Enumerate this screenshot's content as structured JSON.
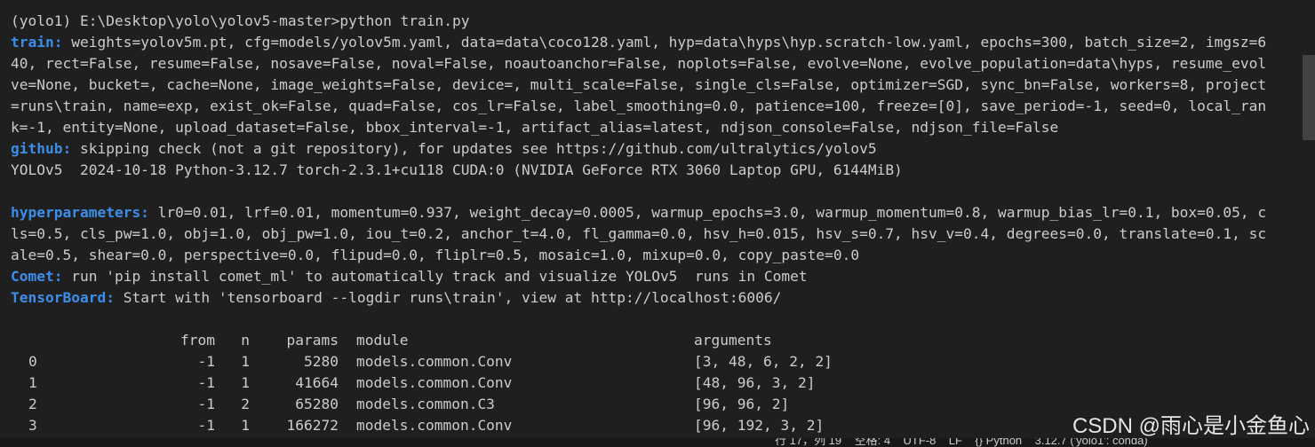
{
  "terminal": {
    "prompt_line": "(yolo1) E:\\Desktop\\yolo\\yolov5-master>python train.py",
    "train": {
      "tag": "train:",
      "lines": [
        " weights=yolov5m.pt, cfg=models/yolov5m.yaml, data=data\\coco128.yaml, hyp=data\\hyps\\hyp.scratch-low.yaml, epochs=300, batch_size=2, imgsz=6",
        "40, rect=False, resume=False, nosave=False, noval=False, noautoanchor=False, noplots=False, evolve=None, evolve_population=data\\hyps, resume_evol",
        "ve=None, bucket=, cache=None, image_weights=False, device=, multi_scale=False, single_cls=False, optimizer=SGD, sync_bn=False, workers=8, project",
        "=runs\\train, name=exp, exist_ok=False, quad=False, cos_lr=False, label_smoothing=0.0, patience=100, freeze=[0], save_period=-1, seed=0, local_ran",
        "k=-1, entity=None, upload_dataset=False, bbox_interval=-1, artifact_alias=latest, ndjson_console=False, ndjson_file=False"
      ]
    },
    "github": {
      "tag": "github:",
      "text": " skipping check (not a git repository), for updates see https://github.com/ultralytics/yolov5"
    },
    "yolo_info": "YOLOv5  2024-10-18 Python-3.12.7 torch-2.3.1+cu118 CUDA:0 (NVIDIA GeForce RTX 3060 Laptop GPU, 6144MiB)",
    "hyperparameters": {
      "tag": "hyperparameters:",
      "lines": [
        " lr0=0.01, lrf=0.01, momentum=0.937, weight_decay=0.0005, warmup_epochs=3.0, warmup_momentum=0.8, warmup_bias_lr=0.1, box=0.05, c",
        "ls=0.5, cls_pw=1.0, obj=1.0, obj_pw=1.0, iou_t=0.2, anchor_t=4.0, fl_gamma=0.0, hsv_h=0.015, hsv_s=0.7, hsv_v=0.4, degrees=0.0, translate=0.1, sc",
        "ale=0.5, shear=0.0, perspective=0.0, flipud=0.0, fliplr=0.5, mosaic=1.0, mixup=0.0, copy_paste=0.0"
      ]
    },
    "comet": {
      "tag": "Comet:",
      "text": " run 'pip install comet_ml' to automatically track and visualize YOLOv5  runs in Comet"
    },
    "tensorboard": {
      "tag": "TensorBoard:",
      "text": " Start with 'tensorboard --logdir runs\\train', view at http://localhost:6006/"
    },
    "model_table": {
      "headers": {
        "from": "from",
        "n": "n",
        "params": "params",
        "module": "module",
        "arguments": "arguments"
      },
      "rows": [
        {
          "idx": "0",
          "from": "-1",
          "n": "1",
          "params": "5280",
          "module": "models.common.Conv",
          "arguments": "[3, 48, 6, 2, 2]"
        },
        {
          "idx": "1",
          "from": "-1",
          "n": "1",
          "params": "41664",
          "module": "models.common.Conv",
          "arguments": "[48, 96, 3, 2]"
        },
        {
          "idx": "2",
          "from": "-1",
          "n": "2",
          "params": "65280",
          "module": "models.common.C3",
          "arguments": "[96, 96, 2]"
        },
        {
          "idx": "3",
          "from": "-1",
          "n": "1",
          "params": "166272",
          "module": "models.common.Conv",
          "arguments": "[96, 192, 3, 2]"
        }
      ]
    }
  },
  "status_bar": {
    "text": "行 17，列 19    空格: 4    UTF-8    LF    {} Python    3.12.7 ('yolo1': conda)"
  },
  "watermark": "CSDN @雨心是小金鱼心",
  "colors": {
    "background": "#1f1f1f",
    "text": "#cccccc",
    "tag": "#3b8eea"
  }
}
